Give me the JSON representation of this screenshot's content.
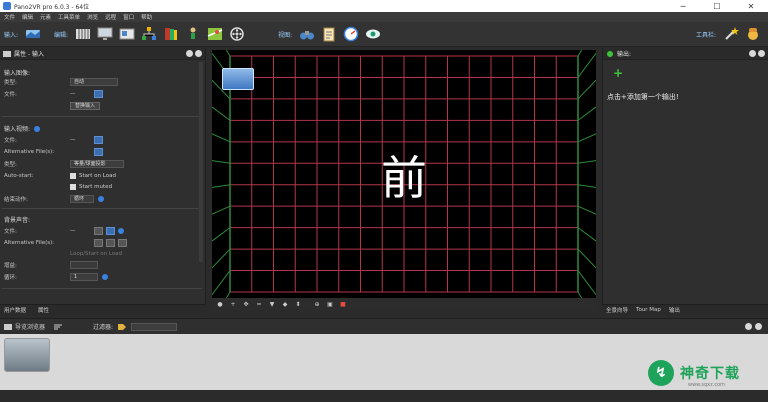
{
  "window": {
    "title": "Pano2VR pro 6.0.3 - 64位",
    "controls": [
      "─",
      "☐",
      "✕"
    ]
  },
  "menu": [
    "文件",
    "编辑",
    "元素",
    "工具菜单",
    "浏览",
    "远程",
    "窗口",
    "帮助"
  ],
  "toolbar": {
    "input_label": "输入:",
    "edit_label": "编辑:",
    "view_label": "视图:",
    "tools_label": "工具栏:"
  },
  "left_panel": {
    "title": "属性 - 输入",
    "input_image_section": "输入图像:",
    "type_label": "类型:",
    "type_value": "自动",
    "file_label": "文件:",
    "file_value": "—",
    "replace_input_button": "替换输入",
    "input_video_section": "输入视频:",
    "video_file_label": "文件:",
    "video_file_value": "—",
    "alt_files_label": "Alternative File(s):",
    "video_type_label": "类型:",
    "video_type_value": "等量/球面投影",
    "autostart_label": "Auto-start:",
    "start_on_load": "Start on Load",
    "start_muted": "Start muted",
    "end_action_label": "结束动作:",
    "end_action_value": "循环",
    "bg_sound_section": "背景声音:",
    "sound_file_label": "文件:",
    "sound_file_value": "—",
    "sound_alt_label": "Alternative File(s):",
    "sound_hint": "Loop/Start on Load",
    "gain_label": "增益:",
    "loop_label": "循环:",
    "loop_value": "1"
  },
  "left_tabs": [
    "用户数据",
    "属性"
  ],
  "viewer": {
    "front_label": "前"
  },
  "right_panel": {
    "title": "输出:",
    "hint": "点击+添加第一个输出!"
  },
  "right_tabs": [
    "全景向导",
    "Tour Map",
    "输出"
  ],
  "tour_browser": {
    "title": "导览浏览器",
    "filter_label": "过滤器:"
  },
  "watermark": {
    "text": "神奇下载",
    "url": "www.sqxz.com"
  },
  "colors": {
    "grid_line": "#b3364a",
    "wall_edge": "#2f8a3a",
    "accent": "#3a82e0"
  }
}
